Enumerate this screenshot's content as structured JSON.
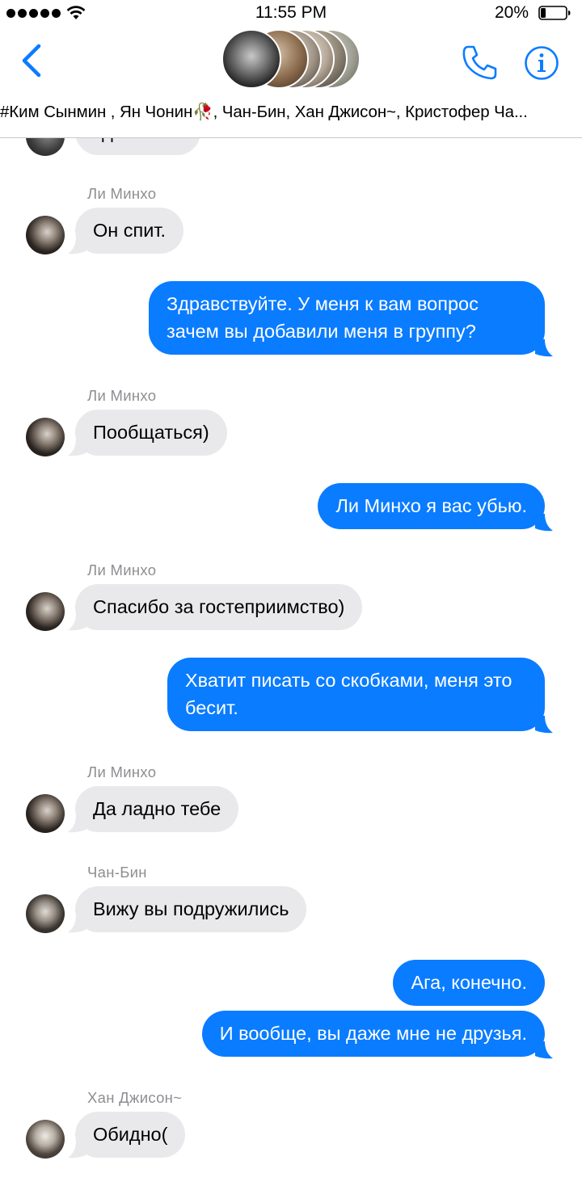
{
  "status_bar": {
    "time": "11:55 PM",
    "battery_percent": "20%",
    "battery_level": 0.2,
    "signal_bars": 5
  },
  "header": {
    "participants": "#Ким Сынмин , Ян Чонин🥀, Чан-Бин, Хан Джисон~, Кристофер Ча...",
    "back_icon": "chevron-left-icon",
    "call_icon": "phone-icon",
    "info_icon": "info-icon",
    "accent_color": "#0a7cff"
  },
  "messages": [
    {
      "direction": "in",
      "text": "Где Хван?",
      "sender": ""
    },
    {
      "direction": "in",
      "sender": "Ли Минхо",
      "text": "Он спит."
    },
    {
      "direction": "out",
      "text": "Здравствуйте. У меня к вам вопрос зачем вы добавили меня в группу?"
    },
    {
      "direction": "in",
      "sender": "Ли Минхо",
      "text": "Пообщаться)"
    },
    {
      "direction": "out",
      "text": "Ли Минхо я вас убью."
    },
    {
      "direction": "in",
      "sender": "Ли Минхо",
      "text": "Спасибо за гостеприимство)"
    },
    {
      "direction": "out",
      "text": "Хватит писать со скобками, меня это бесит."
    },
    {
      "direction": "in",
      "sender": "Ли Минхо",
      "text": "Да ладно тебе"
    },
    {
      "direction": "in",
      "sender": "Чан-Бин",
      "text": "Вижу вы подружились"
    },
    {
      "direction": "out",
      "text": "Ага, конечно."
    },
    {
      "direction": "out",
      "text": "И вообще, вы даже мне не друзья."
    },
    {
      "direction": "in",
      "sender": "Хан Джисон~",
      "text": "Обидно("
    }
  ],
  "colors": {
    "incoming_bubble": "#e9e9eb",
    "outgoing_bubble": "#0a7cff",
    "sender_label": "#8e8e93"
  }
}
